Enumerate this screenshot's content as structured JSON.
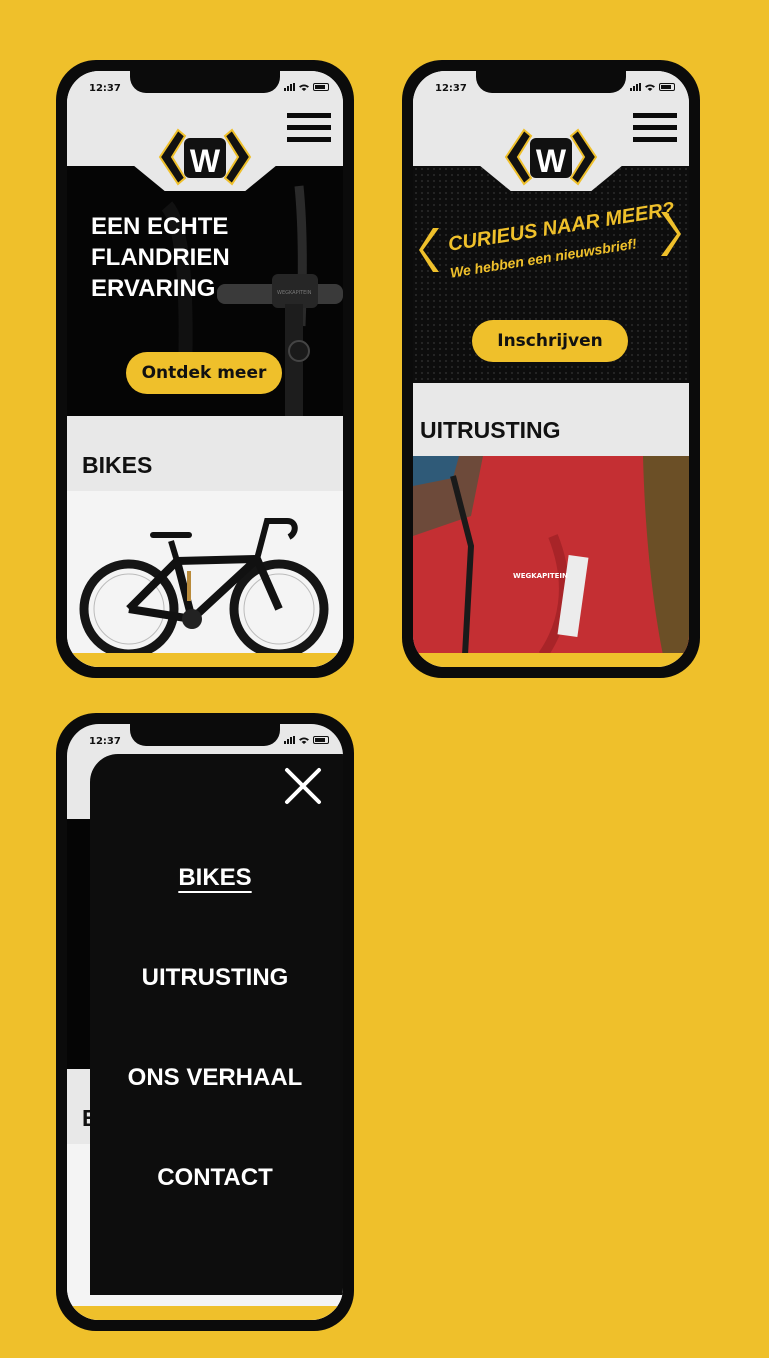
{
  "status_time": "12:37",
  "logo_letter": "W",
  "phone1": {
    "hero_lines": [
      "EEN ECHTE",
      "FLANDRIEN",
      "ERVARING"
    ],
    "cta_label": "Ontdek meer",
    "section_title": "BIKES"
  },
  "phone2": {
    "newsletter_title": "CURIEUS NAAR MEER?",
    "newsletter_subtitle": "We hebben een nieuwsbrief!",
    "cta_label": "Inschrijven",
    "section_title": "UITRUSTING",
    "jersey_brand": "WEGKAPITEIN"
  },
  "phone3": {
    "menu_items": [
      "BIKES",
      "UITRUSTING",
      "ONS VERHAAL",
      "CONTACT"
    ],
    "active_item": "BIKES"
  },
  "colors": {
    "brand_yellow": "#EFC02B",
    "black": "#0b0b0b",
    "light_grey": "#e8e8e8"
  }
}
